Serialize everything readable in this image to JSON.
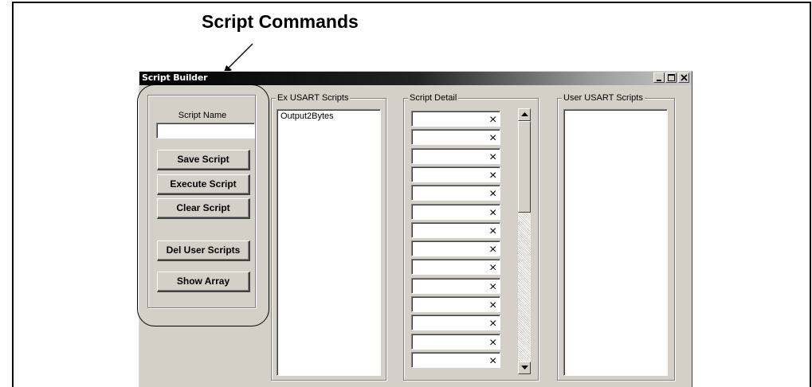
{
  "annotation": {
    "title": "Script Commands"
  },
  "window": {
    "title": "Script Builder",
    "controls": {
      "minimize": "minimize-icon",
      "maximize": "maximize-icon",
      "close": "close-icon"
    }
  },
  "commands": {
    "script_name_label": "Script Name",
    "script_name_value": "",
    "buttons": [
      "Save Script",
      "Execute Script",
      "Clear Script",
      "Del User Scripts",
      "Show Array"
    ]
  },
  "ex_scripts": {
    "title": "Ex USART Scripts",
    "items": [
      "Output2Bytes"
    ]
  },
  "script_detail": {
    "title": "Script Detail",
    "clear_symbol": "×",
    "rows": [
      "",
      "",
      "",
      "",
      "",
      "",
      "",
      "",
      "",
      "",
      "",
      "",
      "",
      ""
    ]
  },
  "user_scripts": {
    "title": "User USART Scripts",
    "items": []
  },
  "colors": {
    "face": "#d4d0c8",
    "titlebar_start": "#000000",
    "titlebar_end": "#c8c8c8"
  }
}
